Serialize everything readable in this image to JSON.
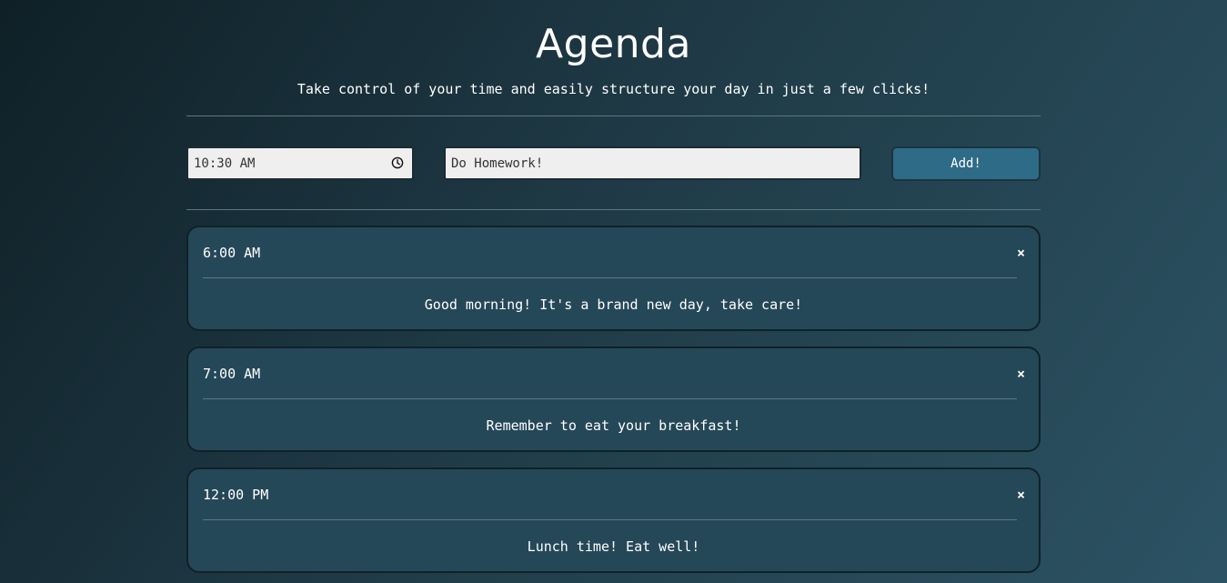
{
  "header": {
    "title": "Agenda",
    "subtitle": "Take control of your time and easily structure your day in just a few clicks!"
  },
  "form": {
    "time_value": "10:30 AM",
    "task_value": "Do Homework!",
    "add_label": "Add!",
    "clock_icon": "clock-icon"
  },
  "agenda": {
    "items": [
      {
        "time": "6:00 AM",
        "text": "Good morning! It's a brand new day, take care!",
        "close": "×"
      },
      {
        "time": "7:00 AM",
        "text": "Remember to eat your breakfast!",
        "close": "×"
      },
      {
        "time": "12:00 PM",
        "text": "Lunch time! Eat well!",
        "close": "×"
      }
    ]
  },
  "colors": {
    "background_start": "#0f2027",
    "background_end": "#2c5364",
    "card": "#254858",
    "button": "#2e6b86"
  }
}
